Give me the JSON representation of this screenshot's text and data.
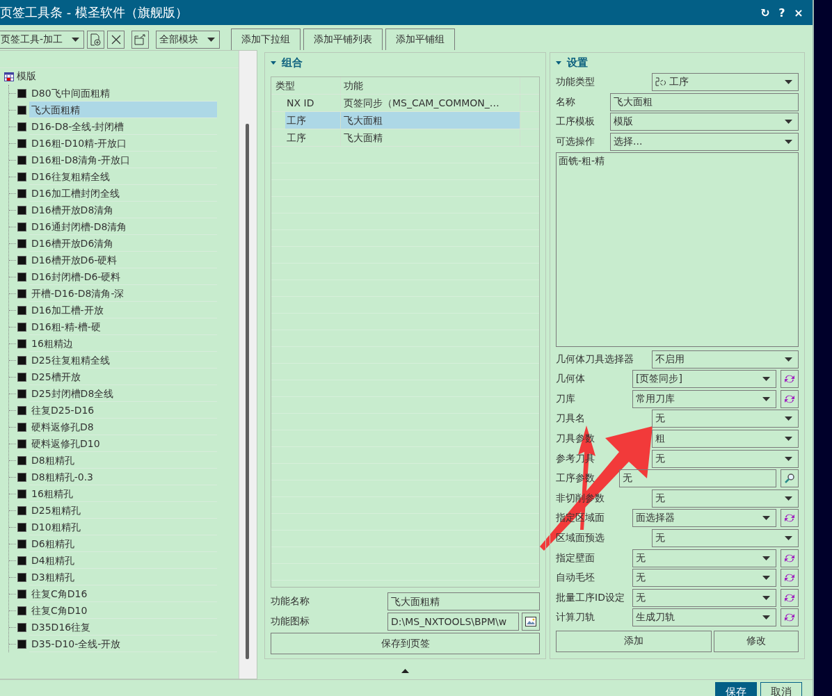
{
  "window": {
    "title": "页签工具条 - 模圣软件（旗舰版）",
    "controls": [
      "↻",
      "?",
      "×"
    ]
  },
  "toolbar": {
    "tool_select": "页签工具-加工",
    "module_select": "全部模块",
    "buttons": [
      "添加下拉组",
      "添加平铺列表",
      "添加平铺组"
    ]
  },
  "tree": {
    "root": {
      "label": "模版",
      "expanded": true,
      "children": [
        {
          "label": "D80飞中间面粗精",
          "selected": false
        },
        {
          "label": "飞大面粗精",
          "selected": true
        },
        {
          "label": "D16-D8-全线-封闭槽",
          "selected": false
        },
        {
          "label": "D16粗-D10精-开放口",
          "selected": false
        },
        {
          "label": "D16粗-D8清角-开放口",
          "selected": false
        },
        {
          "label": "D16往复粗精全线",
          "selected": false
        },
        {
          "label": "D16加工槽封闭全线",
          "selected": false
        },
        {
          "label": "D16槽开放D8清角",
          "selected": false
        },
        {
          "label": "D16通封闭槽-D8清角",
          "selected": false
        },
        {
          "label": "D16槽开放D6清角",
          "selected": false
        },
        {
          "label": "D16槽开放D6-硬料",
          "selected": false
        },
        {
          "label": "D16封闭槽-D6-硬料",
          "selected": false
        },
        {
          "label": "开槽-D16-D8清角-深",
          "selected": false
        },
        {
          "label": "D16加工槽-开放",
          "selected": false
        },
        {
          "label": "D16粗-精-槽-硬",
          "selected": false
        },
        {
          "label": "16粗精边",
          "selected": false
        },
        {
          "label": "D25往复粗精全线",
          "selected": false
        },
        {
          "label": "D25槽开放",
          "selected": false
        },
        {
          "label": "D25封闭槽D8全线",
          "selected": false
        },
        {
          "label": "往复D25-D16",
          "selected": false
        },
        {
          "label": "硬料返修孔D8",
          "selected": false
        },
        {
          "label": "硬料返修孔D10",
          "selected": false
        },
        {
          "label": "D8粗精孔",
          "selected": false
        },
        {
          "label": "D8粗精孔-0.3",
          "selected": false
        },
        {
          "label": "16粗精孔",
          "selected": false
        },
        {
          "label": "D25粗精孔",
          "selected": false
        },
        {
          "label": "D10粗精孔",
          "selected": false
        },
        {
          "label": "D6粗精孔",
          "selected": false
        },
        {
          "label": "D4粗精孔",
          "selected": false
        },
        {
          "label": "D3粗精孔",
          "selected": false
        },
        {
          "label": "往复C角D16",
          "selected": false
        },
        {
          "label": "往复C角D10",
          "selected": false
        },
        {
          "label": "D35D16往复",
          "selected": false
        },
        {
          "label": "D35-D10-全线-开放",
          "selected": false
        }
      ]
    }
  },
  "group": {
    "title": "组合",
    "expanded": true,
    "columns": [
      "类型",
      "功能"
    ],
    "rows": [
      {
        "type": "NX ID",
        "function": "页签同步（MS_CAM_COMMON_…",
        "selected": false
      },
      {
        "type": "工序",
        "function": "飞大面粗",
        "selected": true
      },
      {
        "type": "工序",
        "function": "飞大面精",
        "selected": false
      }
    ],
    "function_name": {
      "label": "功能名称",
      "value": "飞大面粗精"
    },
    "function_icon": {
      "label": "功能图标",
      "value": "D:\\MS_NXTOOLS\\BPM\\w"
    },
    "save_button": "保存到页签"
  },
  "settings": {
    "title": "设置",
    "expanded": true,
    "fields_top": [
      {
        "label": "功能类型",
        "kind": "select",
        "value": "工序"
      },
      {
        "label": "名称",
        "kind": "text",
        "value": "飞大面粗"
      },
      {
        "label": "工序模板",
        "kind": "select",
        "value": "模版"
      },
      {
        "label": "可选操作",
        "kind": "select",
        "value": "选择..."
      }
    ],
    "notes": "面铣-粗-精",
    "fields": [
      {
        "label": "几何体刀具选择器",
        "kind": "select",
        "value": "不启用"
      },
      {
        "label": "几何体",
        "kind": "select-refresh",
        "value": "[页签同步]"
      },
      {
        "label": "刀库",
        "kind": "select-refresh",
        "value": "常用刀库"
      },
      {
        "label": "刀具名",
        "kind": "select",
        "value": "无"
      },
      {
        "label": "刀具参数",
        "kind": "select",
        "value": "粗"
      },
      {
        "label": "参考刀具",
        "kind": "select",
        "value": "无"
      },
      {
        "label": "工序参数",
        "kind": "text-search",
        "value": "无"
      },
      {
        "label": "非切削参数",
        "kind": "select",
        "value": "无"
      },
      {
        "label": "指定区域面",
        "kind": "select-refresh",
        "value": "面选择器"
      },
      {
        "label": "区域面预选",
        "kind": "select",
        "value": "无"
      },
      {
        "label": "指定壁面",
        "kind": "select-refresh",
        "value": "无"
      },
      {
        "label": "自动毛坯",
        "kind": "select-refresh",
        "value": "无"
      },
      {
        "label": "批量工序ID设定",
        "kind": "select-refresh",
        "value": "无"
      },
      {
        "label": "计算刀轨",
        "kind": "select-refresh",
        "value": "生成刀轨"
      }
    ],
    "buttons": [
      "添加",
      "修改"
    ]
  },
  "footer": {
    "buttons": [
      {
        "label": "保存",
        "kind": "primary"
      },
      {
        "label": "取消",
        "kind": "normal"
      }
    ]
  }
}
